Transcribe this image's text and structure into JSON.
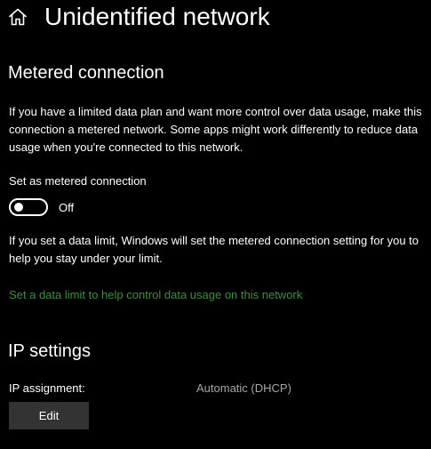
{
  "header": {
    "home_icon": "home-icon",
    "title": "Unidentified network"
  },
  "metered": {
    "heading": "Metered connection",
    "description": "If you have a limited data plan and want more control over data usage, make this connection a metered network. Some apps might work differently to reduce data usage when you're connected to this network.",
    "toggle_label": "Set as metered connection",
    "toggle_on": false,
    "toggle_state": "Off",
    "limit_description": "If you set a data limit, Windows will set the metered connection setting for you to help you stay under your limit.",
    "limit_link": "Set a data limit to help control data usage on this network"
  },
  "ip": {
    "heading": "IP settings",
    "assignment_label": "IP assignment:",
    "assignment_value": "Automatic (DHCP)",
    "edit_label": "Edit"
  },
  "colors": {
    "background": "#000000",
    "text": "#ffffff",
    "secondary_text": "#a6a6a6",
    "link": "#3f8f3f",
    "button": "#333333"
  }
}
